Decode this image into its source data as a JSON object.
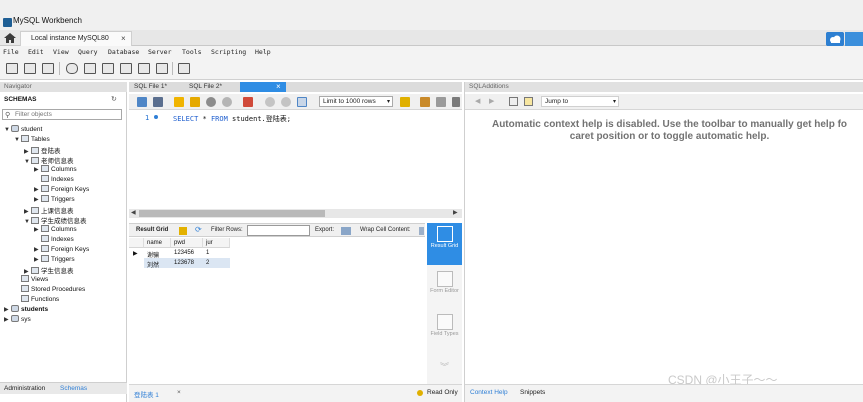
{
  "window": {
    "title": "MySQL Workbench"
  },
  "connection_tab": {
    "label": "Local instance MySQL80",
    "close": "×"
  },
  "menu": [
    "File",
    "Edit",
    "View",
    "Query",
    "Database",
    "Server",
    "Tools",
    "Scripting",
    "Help"
  ],
  "navigator": {
    "header": "Navigator",
    "schemas_label": "SCHEMAS",
    "filter_placeholder": "Filter objects",
    "tree": [
      {
        "label": "student",
        "level": 0,
        "arrow": "▼",
        "icon": "database"
      },
      {
        "label": "Tables",
        "level": 1,
        "arrow": "▼",
        "icon": "folder"
      },
      {
        "label": "登陆表",
        "level": 2,
        "arrow": "▶",
        "icon": "table"
      },
      {
        "label": "老师信息表",
        "level": 2,
        "arrow": "▼",
        "icon": "table"
      },
      {
        "label": "Columns",
        "level": 3,
        "arrow": "▶",
        "icon": "columns"
      },
      {
        "label": "Indexes",
        "level": 3,
        "arrow": "",
        "icon": "indexes"
      },
      {
        "label": "Foreign Keys",
        "level": 3,
        "arrow": "▶",
        "icon": "foreign-keys"
      },
      {
        "label": "Triggers",
        "level": 3,
        "arrow": "▶",
        "icon": "triggers"
      },
      {
        "label": "上课信息表",
        "level": 2,
        "arrow": "▶",
        "icon": "table"
      },
      {
        "label": "学生成绩信息表",
        "level": 2,
        "arrow": "▼",
        "icon": "table"
      },
      {
        "label": "Columns",
        "level": 3,
        "arrow": "▶",
        "icon": "columns"
      },
      {
        "label": "Indexes",
        "level": 3,
        "arrow": "",
        "icon": "indexes"
      },
      {
        "label": "Foreign Keys",
        "level": 3,
        "arrow": "▶",
        "icon": "foreign-keys"
      },
      {
        "label": "Triggers",
        "level": 3,
        "arrow": "▶",
        "icon": "triggers"
      },
      {
        "label": "学生信息表",
        "level": 2,
        "arrow": "▶",
        "icon": "table"
      },
      {
        "label": "Views",
        "level": 1,
        "arrow": "",
        "icon": "folder"
      },
      {
        "label": "Stored Procedures",
        "level": 1,
        "arrow": "",
        "icon": "folder"
      },
      {
        "label": "Functions",
        "level": 1,
        "arrow": "",
        "icon": "folder"
      },
      {
        "label": "students",
        "level": 0,
        "arrow": "▶",
        "icon": "database",
        "bold": true
      },
      {
        "label": "sys",
        "level": 0,
        "arrow": "▶",
        "icon": "database"
      }
    ],
    "tabs": [
      "Administration",
      "Schemas"
    ]
  },
  "editor": {
    "tabs": [
      "SQL File 1*",
      "SQL File 2*",
      ""
    ],
    "tab_close": "×",
    "limit_label": "Limit to 1000 rows",
    "line_number": "1",
    "sql": {
      "keyword_select": "SELECT",
      "star": "*",
      "keyword_from": "FROM",
      "rest": "student.登陆表;"
    }
  },
  "results": {
    "result_grid_label": "Result Grid",
    "filter_rows_label": "Filter Rows:",
    "export_label": "Export:",
    "wrap_label": "Wrap Cell Content:",
    "columns": [
      "name",
      "pwd",
      "jur"
    ],
    "rows": [
      [
        "谢骗",
        "123456",
        "1"
      ],
      [
        "刘然",
        "123678",
        "2"
      ]
    ],
    "side_buttons": [
      "Result Grid",
      "Form Editor",
      "Field Types"
    ],
    "bottom_tab": "登陆表 1",
    "bottom_tab_close": "×",
    "read_only": "Read Only"
  },
  "additions": {
    "header": "SQLAdditions",
    "jump_to": "Jump to",
    "help_line1": "Automatic context help is disabled. Use the toolbar to manually get help fo",
    "help_line2": "caret position or to toggle automatic help.",
    "tabs": [
      "Context Help",
      "Snippets"
    ]
  },
  "watermark": "CSDN @小王子～～",
  "colors": {
    "accent": "#2f8de4",
    "help_text": "#727272",
    "keyword": "#1f5fcf"
  }
}
